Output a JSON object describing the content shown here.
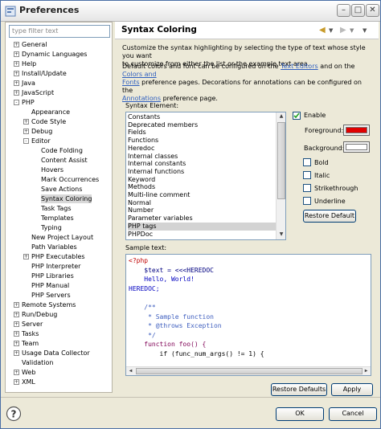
{
  "window": {
    "title": "Preferences",
    "minimize": "–",
    "maximize": "□",
    "close": "✕"
  },
  "filter": {
    "placeholder": "type filter text"
  },
  "tree": {
    "items": [
      {
        "label": "General",
        "level": 0,
        "exp": "+"
      },
      {
        "label": "Dynamic Languages",
        "level": 0,
        "exp": "+"
      },
      {
        "label": "Help",
        "level": 0,
        "exp": "+"
      },
      {
        "label": "Install/Update",
        "level": 0,
        "exp": "+"
      },
      {
        "label": "Java",
        "level": 0,
        "exp": "+"
      },
      {
        "label": "JavaScript",
        "level": 0,
        "exp": "+"
      },
      {
        "label": "PHP",
        "level": 0,
        "exp": "-"
      },
      {
        "label": "Appearance",
        "level": 1,
        "exp": ""
      },
      {
        "label": "Code Style",
        "level": 1,
        "exp": "+"
      },
      {
        "label": "Debug",
        "level": 1,
        "exp": "+"
      },
      {
        "label": "Editor",
        "level": 1,
        "exp": "-"
      },
      {
        "label": "Code Folding",
        "level": 2,
        "exp": ""
      },
      {
        "label": "Content Assist",
        "level": 2,
        "exp": ""
      },
      {
        "label": "Hovers",
        "level": 2,
        "exp": ""
      },
      {
        "label": "Mark Occurrences",
        "level": 2,
        "exp": ""
      },
      {
        "label": "Save Actions",
        "level": 2,
        "exp": ""
      },
      {
        "label": "Syntax Coloring",
        "level": 2,
        "exp": ""
      },
      {
        "label": "Task Tags",
        "level": 2,
        "exp": ""
      },
      {
        "label": "Templates",
        "level": 2,
        "exp": ""
      },
      {
        "label": "Typing",
        "level": 2,
        "exp": ""
      },
      {
        "label": "New Project Layout",
        "level": 1,
        "exp": ""
      },
      {
        "label": "Path Variables",
        "level": 1,
        "exp": ""
      },
      {
        "label": "PHP Executables",
        "level": 1,
        "exp": "+"
      },
      {
        "label": "PHP Interpreter",
        "level": 1,
        "exp": ""
      },
      {
        "label": "PHP Libraries",
        "level": 1,
        "exp": ""
      },
      {
        "label": "PHP Manual",
        "level": 1,
        "exp": ""
      },
      {
        "label": "PHP Servers",
        "level": 1,
        "exp": ""
      },
      {
        "label": "Remote Systems",
        "level": 0,
        "exp": "+"
      },
      {
        "label": "Run/Debug",
        "level": 0,
        "exp": "+"
      },
      {
        "label": "Server",
        "level": 0,
        "exp": "+"
      },
      {
        "label": "Tasks",
        "level": 0,
        "exp": "+"
      },
      {
        "label": "Team",
        "level": 0,
        "exp": "+"
      },
      {
        "label": "Usage Data Collector",
        "level": 0,
        "exp": "+"
      },
      {
        "label": "Validation",
        "level": 0,
        "exp": ""
      },
      {
        "label": "Web",
        "level": 0,
        "exp": "+"
      },
      {
        "label": "XML",
        "level": 0,
        "exp": "+"
      }
    ]
  },
  "page": {
    "title": "Syntax Coloring",
    "desc1a": "Customize the syntax highlighting by selecting the type of text whose style you want",
    "desc1b": "to customize from either the list or the example text area.",
    "desc2a_pre": "Default colors and font can be configured on the ",
    "desc2a_link1": "Text Editors",
    "desc2a_mid": " and on the ",
    "desc2a_link2": "Colors and",
    "desc2b_link2": "Fonts",
    "desc2b_post": " preference pages.  Decorations for annotations can be configured on the",
    "desc2c_link3": "Annotations",
    "desc2c_post": " preference page."
  },
  "syntax": {
    "label": "Syntax Element:",
    "items": [
      "Constants",
      "Deprecated members",
      "Fields",
      "Functions",
      "Heredoc",
      "Internal classes",
      "Internal constants",
      "Internal functions",
      "Keyword",
      "Methods",
      "Multi-line comment",
      "Normal",
      "Number",
      "Parameter variables",
      "PHP tags",
      "PHPDoc"
    ],
    "selected": "PHP tags"
  },
  "options": {
    "enable": "Enable",
    "foreground": "Foreground:",
    "background": "Background:",
    "bold": "Bold",
    "italic": "Italic",
    "strikethrough": "Strikethrough",
    "underline": "Underline",
    "restore": "Restore Default",
    "fg_color": "#e00000",
    "bg_color": "#ffffff"
  },
  "sample": {
    "label": "Sample text:",
    "lines": [
      {
        "text": "<?php",
        "color": "#c00000"
      },
      {
        "text": "    $text = <<<HEREDOC",
        "color": "#000080"
      },
      {
        "text": "    Hello, World!",
        "color": "#0000c0"
      },
      {
        "text": "HEREDOC;",
        "color": "#0000c0"
      },
      {
        "text": "",
        "color": "#000"
      },
      {
        "text": "    /**",
        "color": "#3f5fbf"
      },
      {
        "text": "     * Sample function",
        "color": "#3f5fbf"
      },
      {
        "text": "     * @throws Exception",
        "color": "#3f5fbf"
      },
      {
        "text": "     */",
        "color": "#3f5fbf"
      },
      {
        "text": "    function foo() {",
        "color": "#7f0055"
      },
      {
        "text": "        if (func_num_args() != 1) {",
        "color": "#000000"
      }
    ]
  },
  "buttons": {
    "restore_defaults": "Restore Defaults",
    "apply": "Apply",
    "ok": "OK",
    "cancel": "Cancel"
  },
  "colors": {
    "accent": "#316ac5"
  }
}
